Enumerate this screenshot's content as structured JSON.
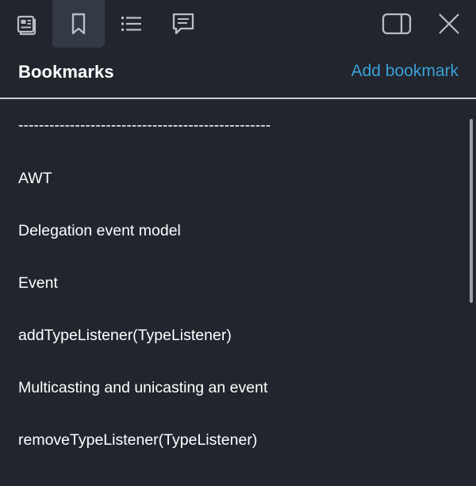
{
  "toolbar": {
    "tabs": [
      {
        "id": "document",
        "icon": "document-icon"
      },
      {
        "id": "bookmarks",
        "icon": "bookmark-icon",
        "active": true
      },
      {
        "id": "contents",
        "icon": "list-icon"
      },
      {
        "id": "comments",
        "icon": "comment-icon"
      }
    ],
    "actions": [
      {
        "id": "toggle-sidebar",
        "icon": "sidebar-panel-icon"
      },
      {
        "id": "close",
        "icon": "close-icon"
      }
    ]
  },
  "header": {
    "title": "Bookmarks",
    "add_label": "Add bookmark"
  },
  "bookmarks": [
    "-------------------------------------------------",
    "AWT",
    "Delegation event model",
    "Event",
    "addTypeListener(TypeListener)",
    "Multicasting and unicasting an event",
    "removeTypeListener(TypeListener)"
  ],
  "colors": {
    "background": "#22252d",
    "active_tab": "#333a45",
    "accent_link": "#3aa0d8",
    "divider": "#c9cbd0",
    "icon": "#b9bdc4"
  }
}
